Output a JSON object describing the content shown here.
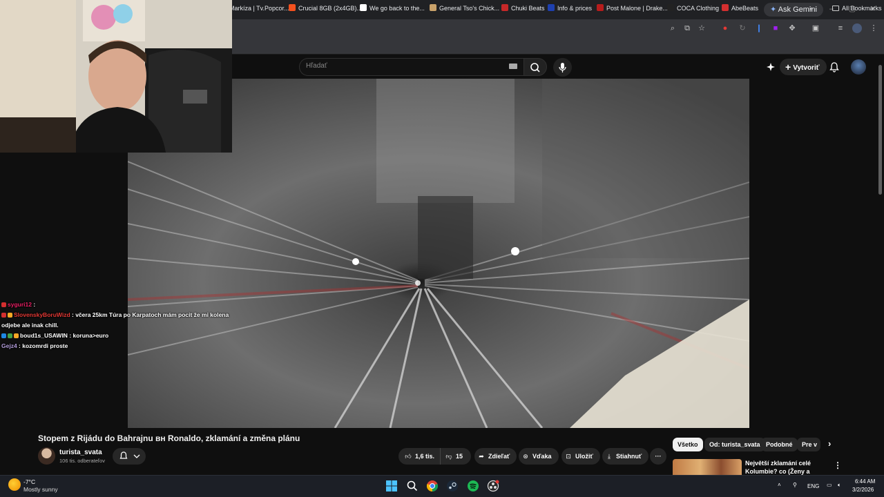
{
  "browser": {
    "ask_gemini": "Ask Gemini",
    "bookmarks": [
      {
        "label": "Markíza | Tv.Popcor...",
        "color": "#e53935"
      },
      {
        "label": "Crucial 8GB (2x4GB)...",
        "color": "#f4511e"
      },
      {
        "label": "We go back to the...",
        "color": "#ffffff"
      },
      {
        "label": "General Tso's Chick...",
        "color": "#c9a26a"
      },
      {
        "label": "Chuki Beats",
        "color": "#c62828"
      },
      {
        "label": "Info & prices",
        "color": "#1e40af"
      },
      {
        "label": "Post Malone | Drake...",
        "color": "#b71c1c"
      },
      {
        "label": "COCA Clothing",
        "color": "#222222"
      },
      {
        "label": "AbeBeats",
        "color": "#d32f2f"
      }
    ],
    "all_bookmarks": "All Bookmarks"
  },
  "youtube": {
    "search_placeholder": "Hľadať",
    "create_label": "Vytvoriť",
    "video_title": "Stopem z Rijádu do Bahrajnu вн Ronaldo, zklamání a změna plánu",
    "channel_name": "turista_svata",
    "channel_subs": "106 tis. odberateľov",
    "likes": "1,6 tis.",
    "dislikes": "15",
    "share": "Zdieľať",
    "thanks": "Vďaka",
    "save": "Uložiť",
    "download": "Stiahnuť",
    "chips": [
      "Všetko",
      "Od: turista_svata",
      "Podobné",
      "Pre v"
    ],
    "recommended_title": "Největší zklamání celé Kolumbie? co (Ženy a Krádeže)"
  },
  "chat": [
    {
      "user": "syguri12",
      "message": "",
      "user_color": "#e91e63",
      "badges": [
        "#d32f2f"
      ]
    },
    {
      "user": "SlovenskyBoruWizd",
      "message": "včera 25km Túra po Karpatoch mám pocit že mi kolena odjebe ale inak chill.",
      "user_color": "#e53935",
      "badges": [
        "#d32f2f",
        "#f9a825"
      ]
    },
    {
      "user": "boud1s_USAWIN",
      "message": "koruna>euro",
      "user_color": "#ffffff",
      "badges": [
        "#1e88e5",
        "#43a047",
        "#f9a825"
      ]
    },
    {
      "user": "Gejz4",
      "message": "kozomrdi proste",
      "user_color": "#b39ddb",
      "badges": []
    }
  ],
  "taskbar": {
    "weather_temp": "-7°C",
    "weather_desc": "Mostly sunny",
    "lang": "ENG",
    "time": "6:44 AM",
    "date": "3/2/2026"
  }
}
